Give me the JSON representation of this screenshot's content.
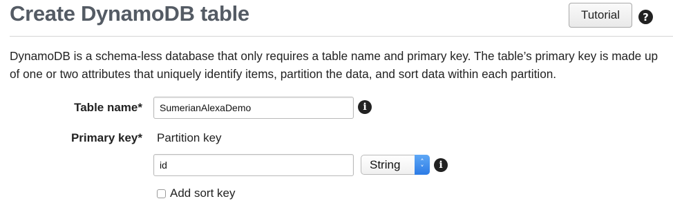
{
  "header": {
    "title": "Create DynamoDB table",
    "tutorial_label": "Tutorial",
    "help_glyph": "?",
    "help_icon": "question-circle-icon"
  },
  "description": "DynamoDB is a schema-less database that only requires a table name and primary key. The table’s primary key is made up of one or two attributes that uniquely identify items, partition the data, and sort data within each partition.",
  "form": {
    "table_name": {
      "label": "Table name*",
      "value": "SumerianAlexaDemo",
      "info_glyph": "i",
      "info_icon": "info-circle-icon"
    },
    "primary_key": {
      "label": "Primary key*",
      "partition_label": "Partition key",
      "partition_value": "id",
      "type_selected": "String",
      "select_arrows": [
        "˄",
        "˅"
      ],
      "info_glyph": "i",
      "info_icon": "info-circle-icon"
    },
    "sort_key": {
      "label": "Add sort key",
      "checked": false
    }
  },
  "colors": {
    "title": "#545b64",
    "select_accent": "#2c7be5",
    "divider": "#d5d5d5"
  }
}
